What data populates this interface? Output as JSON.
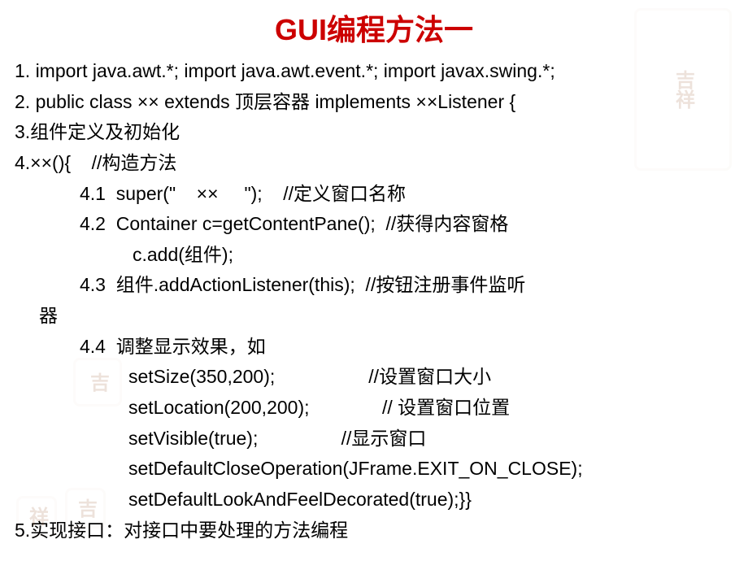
{
  "title": "GUI编程方法一",
  "lines": {
    "l1": "1. import java.awt.*; import java.awt.event.*; import javax.swing.*;",
    "l2": "2. public class ×× extends 顶层容器 implements ××Listener {",
    "l3": "3.组件定义及初始化",
    "l4": "4.××(){    //构造方法",
    "l4_1": "4.1  super(\"    ××     \");    //定义窗口名称",
    "l4_2": "4.2  Container c=getContentPane();  //获得内容窗格",
    "l4_2b": "c.add(组件);",
    "l4_3": "4.3  组件.addActionListener(this);  //按钮注册事件监听",
    "l4_3b": "器",
    "l4_4": "4.4  调整显示效果，如",
    "l4_4a": "setSize(350,200);                  //设置窗口大小",
    "l4_4b": "setLocation(200,200);              // 设置窗口位置",
    "l4_4c": "setVisible(true);                //显示窗口",
    "l4_4d": "setDefaultCloseOperation(JFrame.EXIT_ON_CLOSE);",
    "l4_4e": "setDefaultLookAndFeelDecorated(true);}}",
    "l5": "5.实现接口：对接口中要处理的方法编程"
  }
}
